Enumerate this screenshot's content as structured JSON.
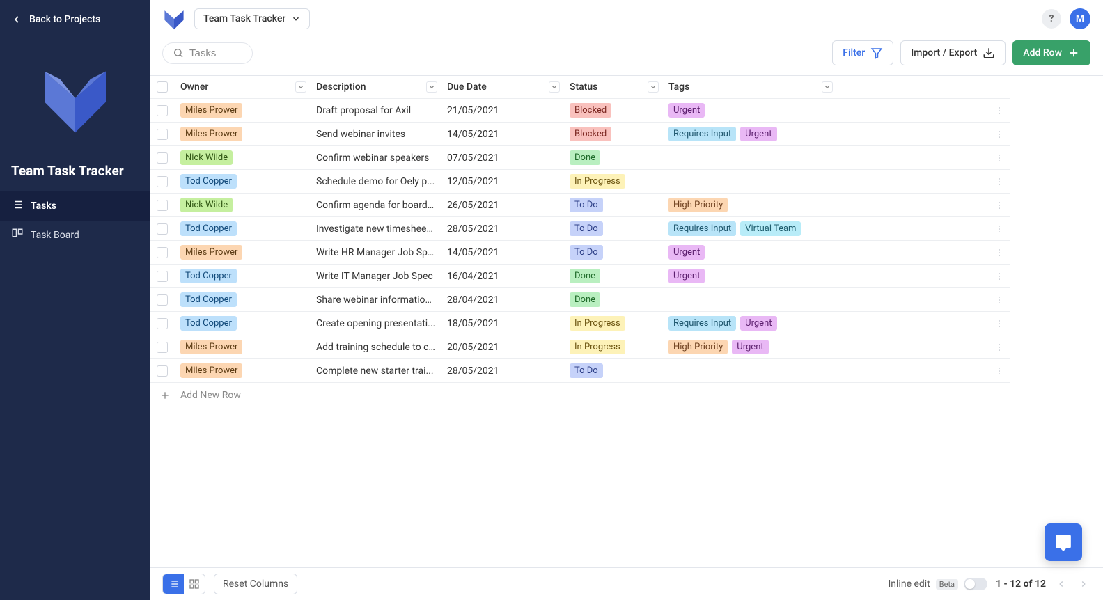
{
  "sidebar": {
    "back_label": "Back to Projects",
    "project_title": "Team Task Tracker",
    "nav": [
      {
        "label": "Tasks",
        "active": true
      },
      {
        "label": "Task Board",
        "active": false
      }
    ]
  },
  "topbar": {
    "project_selector_label": "Team Task Tracker",
    "help_label": "?",
    "avatar_initial": "M"
  },
  "toolbar": {
    "search_placeholder": "Tasks",
    "filter_label": "Filter",
    "import_export_label": "Import / Export",
    "add_row_label": "Add Row"
  },
  "columns": {
    "owner": "Owner",
    "description": "Description",
    "due_date": "Due Date",
    "status": "Status",
    "tags": "Tags"
  },
  "owners": {
    "miles": {
      "label": "Miles Prower",
      "class": "owner-miles"
    },
    "nick": {
      "label": "Nick Wilde",
      "class": "owner-nick"
    },
    "tod": {
      "label": "Tod Copper",
      "class": "owner-tod"
    }
  },
  "statuses": {
    "blocked": {
      "label": "Blocked",
      "class": "status-blocked"
    },
    "done": {
      "label": "Done",
      "class": "status-done"
    },
    "inprogress": {
      "label": "In Progress",
      "class": "status-inprogress"
    },
    "todo": {
      "label": "To Do",
      "class": "status-todo"
    }
  },
  "tags": {
    "urgent": {
      "label": "Urgent",
      "class": "tag-urgent"
    },
    "requires": {
      "label": "Requires Input",
      "class": "tag-requires"
    },
    "high": {
      "label": "High Priority",
      "class": "tag-high"
    },
    "virtual": {
      "label": "Virtual Team",
      "class": "tag-virtual"
    }
  },
  "rows": [
    {
      "owner": "miles",
      "description": "Draft proposal for Axil",
      "due": "21/05/2021",
      "status": "blocked",
      "tags": [
        "urgent"
      ]
    },
    {
      "owner": "miles",
      "description": "Send webinar invites",
      "due": "14/05/2021",
      "status": "blocked",
      "tags": [
        "requires",
        "urgent"
      ]
    },
    {
      "owner": "nick",
      "description": "Confirm webinar speakers",
      "due": "07/05/2021",
      "status": "done",
      "tags": []
    },
    {
      "owner": "tod",
      "description": "Schedule demo for Oely p...",
      "due": "12/05/2021",
      "status": "inprogress",
      "tags": []
    },
    {
      "owner": "nick",
      "description": "Confirm agenda for board ...",
      "due": "26/05/2021",
      "status": "todo",
      "tags": [
        "high"
      ]
    },
    {
      "owner": "tod",
      "description": "Investigate new timesheet...",
      "due": "28/05/2021",
      "status": "todo",
      "tags": [
        "requires",
        "virtual"
      ]
    },
    {
      "owner": "miles",
      "description": "Write HR Manager Job Spec",
      "due": "14/05/2021",
      "status": "todo",
      "tags": [
        "urgent"
      ]
    },
    {
      "owner": "tod",
      "description": "Write IT Manager Job Spec",
      "due": "16/04/2021",
      "status": "done",
      "tags": [
        "urgent"
      ]
    },
    {
      "owner": "tod",
      "description": "Share webinar information...",
      "due": "28/04/2021",
      "status": "done",
      "tags": []
    },
    {
      "owner": "tod",
      "description": "Create opening presentati...",
      "due": "18/05/2021",
      "status": "inprogress",
      "tags": [
        "requires",
        "urgent"
      ]
    },
    {
      "owner": "miles",
      "description": "Add training schedule to c...",
      "due": "20/05/2021",
      "status": "inprogress",
      "tags": [
        "high",
        "urgent"
      ]
    },
    {
      "owner": "miles",
      "description": "Complete new starter trai...",
      "due": "28/05/2021",
      "status": "todo",
      "tags": []
    }
  ],
  "add_new_row_label": "Add New Row",
  "footer": {
    "reset_columns_label": "Reset Columns",
    "inline_edit_label": "Inline edit",
    "beta_label": "Beta",
    "pager_text": "1 - 12 of 12"
  }
}
